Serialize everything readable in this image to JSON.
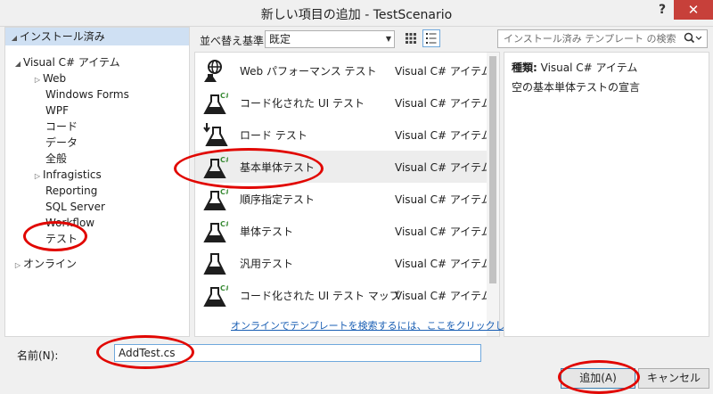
{
  "window": {
    "title": "新しい項目の追加 - TestScenario",
    "help_label": "?",
    "close_label": "✕"
  },
  "tree": {
    "header": "インストール済み",
    "root": "Visual C# アイテム",
    "children": [
      "Web",
      "Windows Forms",
      "WPF",
      "コード",
      "データ",
      "全般",
      "Infragistics",
      "Reporting",
      "SQL Server",
      "Workflow",
      "テスト"
    ],
    "online": "オンライン"
  },
  "toolbar": {
    "sort_label": "並べ替え基準:",
    "sort_value": "既定",
    "search_placeholder": "インストール済み テンプレート の検索 (Ctrl"
  },
  "templates": [
    {
      "name": "Web パフォーマンス テスト",
      "type": "Visual C# アイテム",
      "icon": "globe-flask-icon"
    },
    {
      "name": "コード化された UI テスト",
      "type": "Visual C# アイテム",
      "icon": "flask-csharp-icon"
    },
    {
      "name": "ロード テスト",
      "type": "Visual C# アイテム",
      "icon": "load-flask-icon"
    },
    {
      "name": "基本単体テスト",
      "type": "Visual C# アイテム",
      "icon": "flask-csharp-icon",
      "selected": true
    },
    {
      "name": "順序指定テスト",
      "type": "Visual C# アイテム",
      "icon": "flask-csharp-icon"
    },
    {
      "name": "単体テスト",
      "type": "Visual C# アイテム",
      "icon": "flask-csharp-icon"
    },
    {
      "name": "汎用テスト",
      "type": "Visual C# アイテム",
      "icon": "flask-icon"
    },
    {
      "name": "コード化された UI テスト マップ",
      "type": "Visual C# アイテム",
      "icon": "flask-csharp-icon"
    }
  ],
  "online_link": "オンラインでテンプレートを検索するには、ここをクリックします。",
  "details": {
    "type_label": "種類:",
    "type_value": "Visual C# アイテム",
    "description": "空の基本単体テストの宣言"
  },
  "form": {
    "name_label": "名前(N):",
    "name_value": "AddTest.cs"
  },
  "buttons": {
    "add": "追加(A)",
    "cancel": "キャンセル"
  },
  "colors": {
    "selection_header": "#cfe0f3",
    "link": "#1a5fb4",
    "annotation": "#e10600",
    "close": "#c7403a"
  }
}
